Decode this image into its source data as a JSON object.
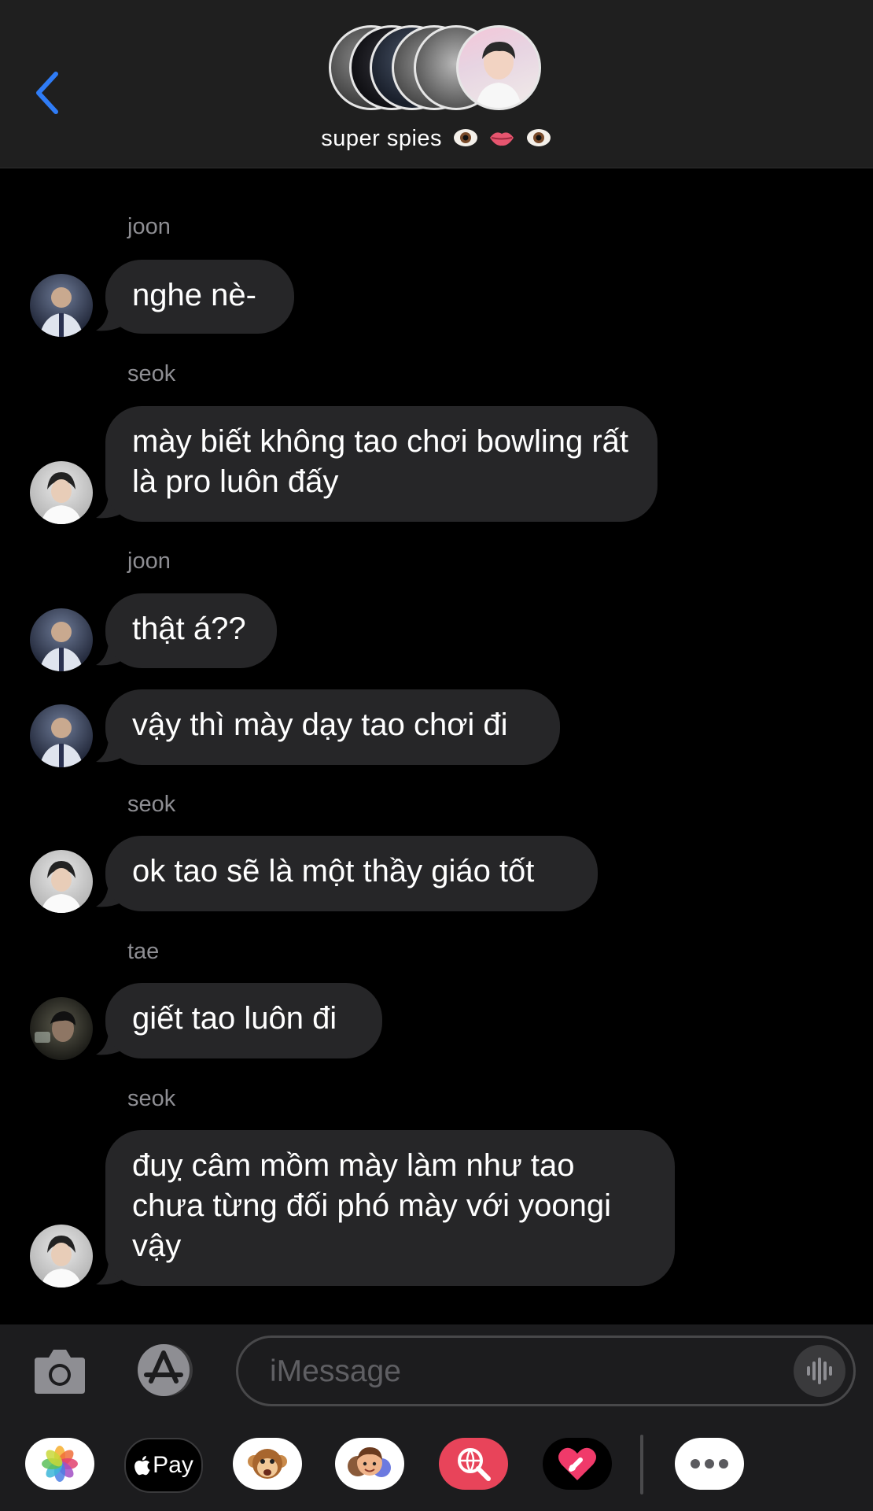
{
  "header": {
    "group_name": "super spies",
    "group_name_emojis": [
      "eye-emoji",
      "lips-emoji",
      "eye-emoji"
    ],
    "accent_color": "#2f7cf6"
  },
  "messages": [
    {
      "sender": "joon",
      "text": "nghe nè-"
    },
    {
      "sender": "seok",
      "text": "mày biết không tao chơi bowling rất là pro luôn đấy"
    },
    {
      "sender": "joon",
      "text": "thật á??"
    },
    {
      "text": "vậy thì mày dạy tao chơi đi"
    },
    {
      "sender": "seok",
      "text": "ok tao sẽ là một thầy giáo tốt"
    },
    {
      "sender": "tae",
      "text": "giết tao luôn đi"
    },
    {
      "sender": "seok",
      "text": "đuỵ câm mồm mày làm như tao chưa từng đối phó mày với yoongi vậy"
    }
  ],
  "input": {
    "placeholder": "iMessage"
  },
  "app_drawer": {
    "items": [
      "photos-app",
      "apple-pay-app",
      "animoji-app",
      "memoji-app",
      "web-search-app",
      "digital-touch-app",
      "more-apps"
    ],
    "apple_pay_label": "Pay"
  },
  "colors": {
    "background": "#000000",
    "bubble": "#262628",
    "header": "#1f1f1f",
    "sender_label": "#8e8e93"
  }
}
